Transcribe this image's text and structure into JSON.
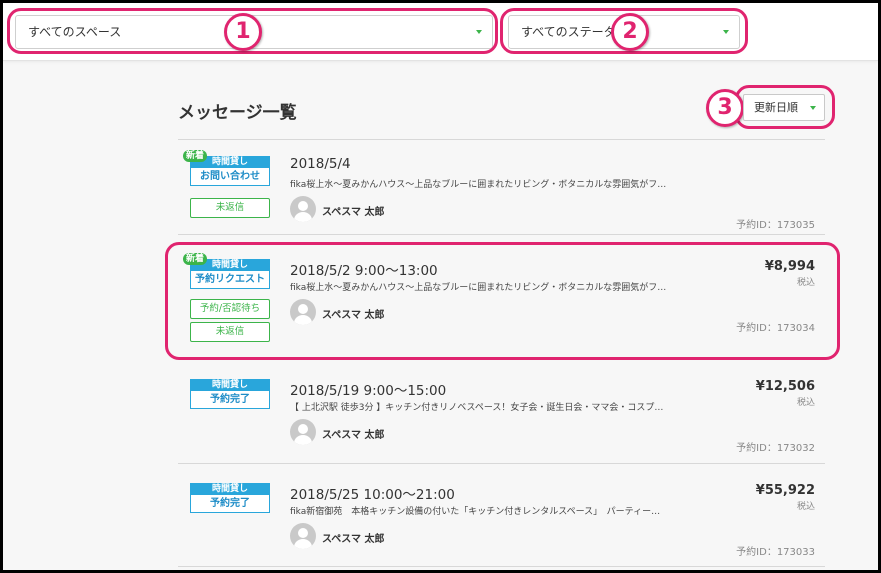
{
  "filters": {
    "space": "すべてのスペース",
    "status": "すべてのステータス"
  },
  "annotations": [
    "1",
    "2",
    "3"
  ],
  "page_title": "メッセージ一覧",
  "sort": {
    "label": "更新日順"
  },
  "messages": [
    {
      "new_tag": "新着",
      "type": "時間貸し",
      "kind": "お問い合わせ",
      "status_tags": [
        "未返信"
      ],
      "date": "2018/5/4",
      "desc": "fika桜上水〜夏みかんハウス〜上品なブルーに囲まれたリビング・ボタニカルな雰囲気がフ…",
      "user": "スペスマ 太郎",
      "price": "",
      "tax": "",
      "reservation_id": "予約ID：173035"
    },
    {
      "new_tag": "新着",
      "type": "時間貸し",
      "kind": "予約リクエスト",
      "status_tags": [
        "予約/否認待ち",
        "未返信"
      ],
      "date": "2018/5/2 9:00〜13:00",
      "desc": "fika桜上水〜夏みかんハウス〜上品なブルーに囲まれたリビング・ボタニカルな雰囲気がフ…",
      "user": "スペスマ 太郎",
      "price": "¥8,994",
      "tax": "税込",
      "reservation_id": "予約ID：173034"
    },
    {
      "new_tag": "",
      "type": "時間貸し",
      "kind": "予約完了",
      "status_tags": [],
      "date": "2018/5/19 9:00〜15:00",
      "desc": "【 上北沢駅 徒歩3分 】キッチン付きリノベスペース！女子会・誕生日会・ママ会・コスプ…",
      "user": "スペスマ 太郎",
      "price": "¥12,506",
      "tax": "税込",
      "reservation_id": "予約ID：173032"
    },
    {
      "new_tag": "",
      "type": "時間貸し",
      "kind": "予約完了",
      "status_tags": [],
      "date": "2018/5/25 10:00〜21:00",
      "desc": "fika新宿御苑　本格キッチン設備の付いた「キッチン付きレンタルスペース」　パーティー…",
      "user": "スペスマ 太郎",
      "price": "¥55,922",
      "tax": "税込",
      "reservation_id": "予約ID：173033"
    }
  ],
  "colors": {
    "highlight": "#e0246f",
    "accent_green": "#3cb44a",
    "badge_blue": "#29a6db"
  }
}
